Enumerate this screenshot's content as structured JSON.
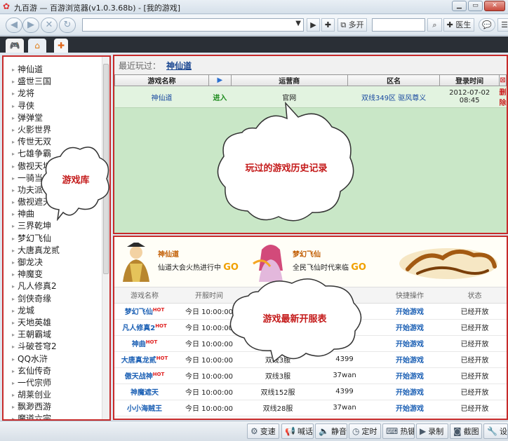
{
  "window": {
    "title": "九百游 — 百游浏览器(v1.0.3.68b) - [我的游戏]",
    "controls": [
      "minimize",
      "maximize",
      "close"
    ]
  },
  "toolbar": {
    "multi_open_label": "多开",
    "doctor_label": "医生"
  },
  "tabs": [
    {
      "icon": "gamepad-icon",
      "active": true
    },
    {
      "icon": "home-icon",
      "active": false
    },
    {
      "icon": "plus-icon",
      "active": false
    }
  ],
  "sidebar": {
    "items": [
      "神仙道",
      "盛世三国",
      "龙将",
      "寻侠",
      "弹弹堂",
      "火影世界",
      "传世无双",
      "七雄争霸",
      "傲视天地",
      "一骑当千",
      "功夫派",
      "傲视遮天",
      "神曲",
      "三界乾坤",
      "梦幻飞仙",
      "大唐真龙贰",
      "御龙决",
      "神魔变",
      "凡人修真2",
      "剑侠奇缘",
      "龙城",
      "天地英雄",
      "王朝霸域",
      "斗破苍穹2",
      "QQ水浒",
      "玄仙传奇",
      "一代宗师",
      "胡莱创业",
      "飘渺西游",
      "魔道六宗"
    ]
  },
  "recent": {
    "label": "最近玩过：",
    "game": "神仙道"
  },
  "history_table": {
    "headers": [
      "游戏名称",
      "",
      "运营商",
      "区名",
      "登录时间",
      ""
    ],
    "rows": [
      {
        "game": "神仙道",
        "action": "进入",
        "operator": "官网",
        "zone": "双线349区 驱风尊义",
        "time": "2012-07-02 08:45",
        "delete": "删除"
      }
    ]
  },
  "banners": [
    {
      "title": "神仙道",
      "text": "仙道大会火热进行中",
      "go": "GO"
    },
    {
      "title": "梦幻飞仙",
      "text": "全民飞仙时代来临",
      "go": "GO"
    },
    {
      "title": "",
      "text": "",
      "go": ""
    }
  ],
  "servers_table": {
    "headers": [
      "游戏名称",
      "开服时间",
      "",
      "",
      "快捷操作",
      "状态"
    ],
    "rows": [
      {
        "game": "梦幻飞仙",
        "hot": true,
        "time": "今日 10:00:00",
        "server": "",
        "operator": "",
        "action": "开始游戏",
        "status": "已经开放"
      },
      {
        "game": "凡人修真2",
        "hot": true,
        "time": "今日 10:00:00",
        "server": "",
        "operator": "",
        "action": "开始游戏",
        "status": "已经开放"
      },
      {
        "game": "神曲",
        "hot": true,
        "time": "今日 10:00:00",
        "server": "",
        "operator": "",
        "action": "开始游戏",
        "status": "已经开放"
      },
      {
        "game": "大唐真龙贰",
        "hot": true,
        "time": "今日 10:00:00",
        "server": "双线3服",
        "operator": "4399",
        "action": "开始游戏",
        "status": "已经开放"
      },
      {
        "game": "傲天战神",
        "hot": true,
        "time": "今日 10:00:00",
        "server": "双线3服",
        "operator": "37wan",
        "action": "开始游戏",
        "status": "已经开放"
      },
      {
        "game": "神魔遮天",
        "hot": false,
        "time": "今日 10:00:00",
        "server": "双线152服",
        "operator": "4399",
        "action": "开始游戏",
        "status": "已经开放"
      },
      {
        "game": "小小海贼王",
        "hot": false,
        "time": "今日 10:00:00",
        "server": "双线28服",
        "operator": "37wan",
        "action": "开始游戏",
        "status": "已经开放"
      }
    ]
  },
  "callouts": {
    "library": "游戏库",
    "history": "玩过的游戏历史记录",
    "servers": "游戏最新开服表"
  },
  "statusbar": {
    "buttons": [
      "变速",
      "喊话",
      "静音",
      "定时",
      "热键",
      "录制",
      "截图",
      "设置"
    ]
  },
  "colors": {
    "highlight_border": "#c72a2a",
    "history_bg": "#c9e7c7",
    "link_blue": "#1a5fb4"
  }
}
